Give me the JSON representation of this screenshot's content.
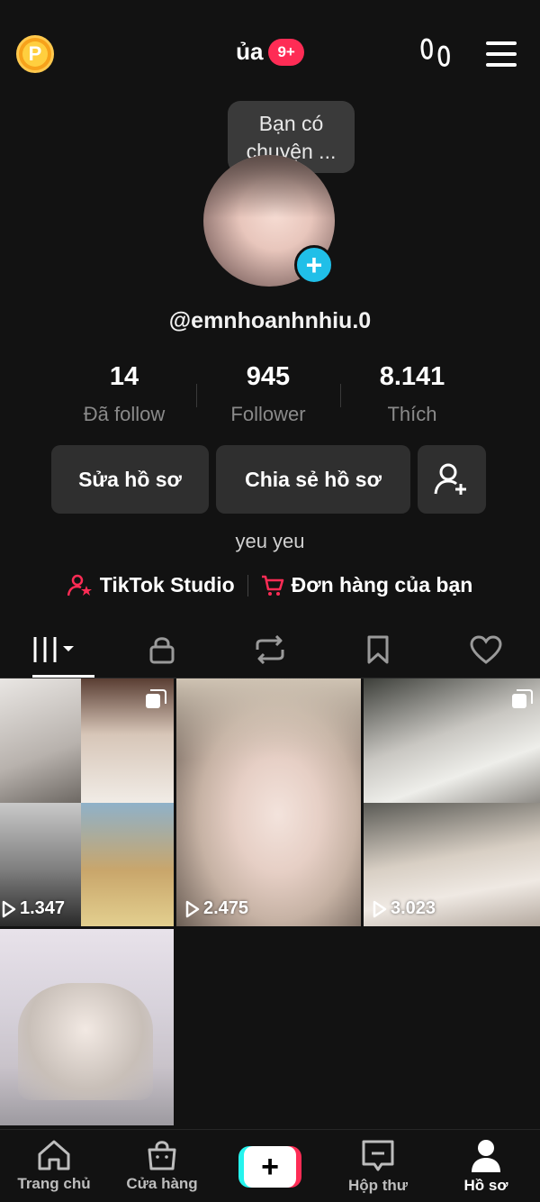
{
  "header": {
    "title": "ủa",
    "notification_badge": "9+",
    "coin_letter": "P"
  },
  "tooltip": {
    "text": "Bạn có chuyện ..."
  },
  "profile": {
    "username": "@emnhoanhnhiu.0",
    "bio": "yeu yeu"
  },
  "stats": [
    {
      "value": "14",
      "label": "Đã follow"
    },
    {
      "value": "945",
      "label": "Follower"
    },
    {
      "value": "8.141",
      "label": "Thích"
    }
  ],
  "actions": {
    "edit_label": "Sửa hồ sơ",
    "share_label": "Chia sẻ hồ sơ"
  },
  "links": {
    "studio_label": "TikTok Studio",
    "orders_label": "Đơn hàng của bạn"
  },
  "tabs": [
    {
      "icon": "grid-icon",
      "active": true
    },
    {
      "icon": "lock-icon",
      "active": false
    },
    {
      "icon": "repost-icon",
      "active": false
    },
    {
      "icon": "bookmark-icon",
      "active": false
    },
    {
      "icon": "heart-icon",
      "active": false
    }
  ],
  "videos": [
    {
      "views": "1.347"
    },
    {
      "views": "2.475"
    },
    {
      "views": "3.023"
    },
    {
      "views": ""
    }
  ],
  "bottom_nav": [
    {
      "label": "Trang chủ",
      "icon": "home-icon",
      "active": false
    },
    {
      "label": "Cửa hàng",
      "icon": "shop-icon",
      "active": false
    },
    {
      "label": "",
      "icon": "plus-icon",
      "active": false
    },
    {
      "label": "Hộp thư",
      "icon": "inbox-icon",
      "active": false
    },
    {
      "label": "Hồ sơ",
      "icon": "profile-icon",
      "active": true
    }
  ],
  "colors": {
    "background": "#121212",
    "accent_red": "#fe2c55",
    "accent_cyan": "#25f4ee",
    "avatar_add": "#20bfe8"
  }
}
